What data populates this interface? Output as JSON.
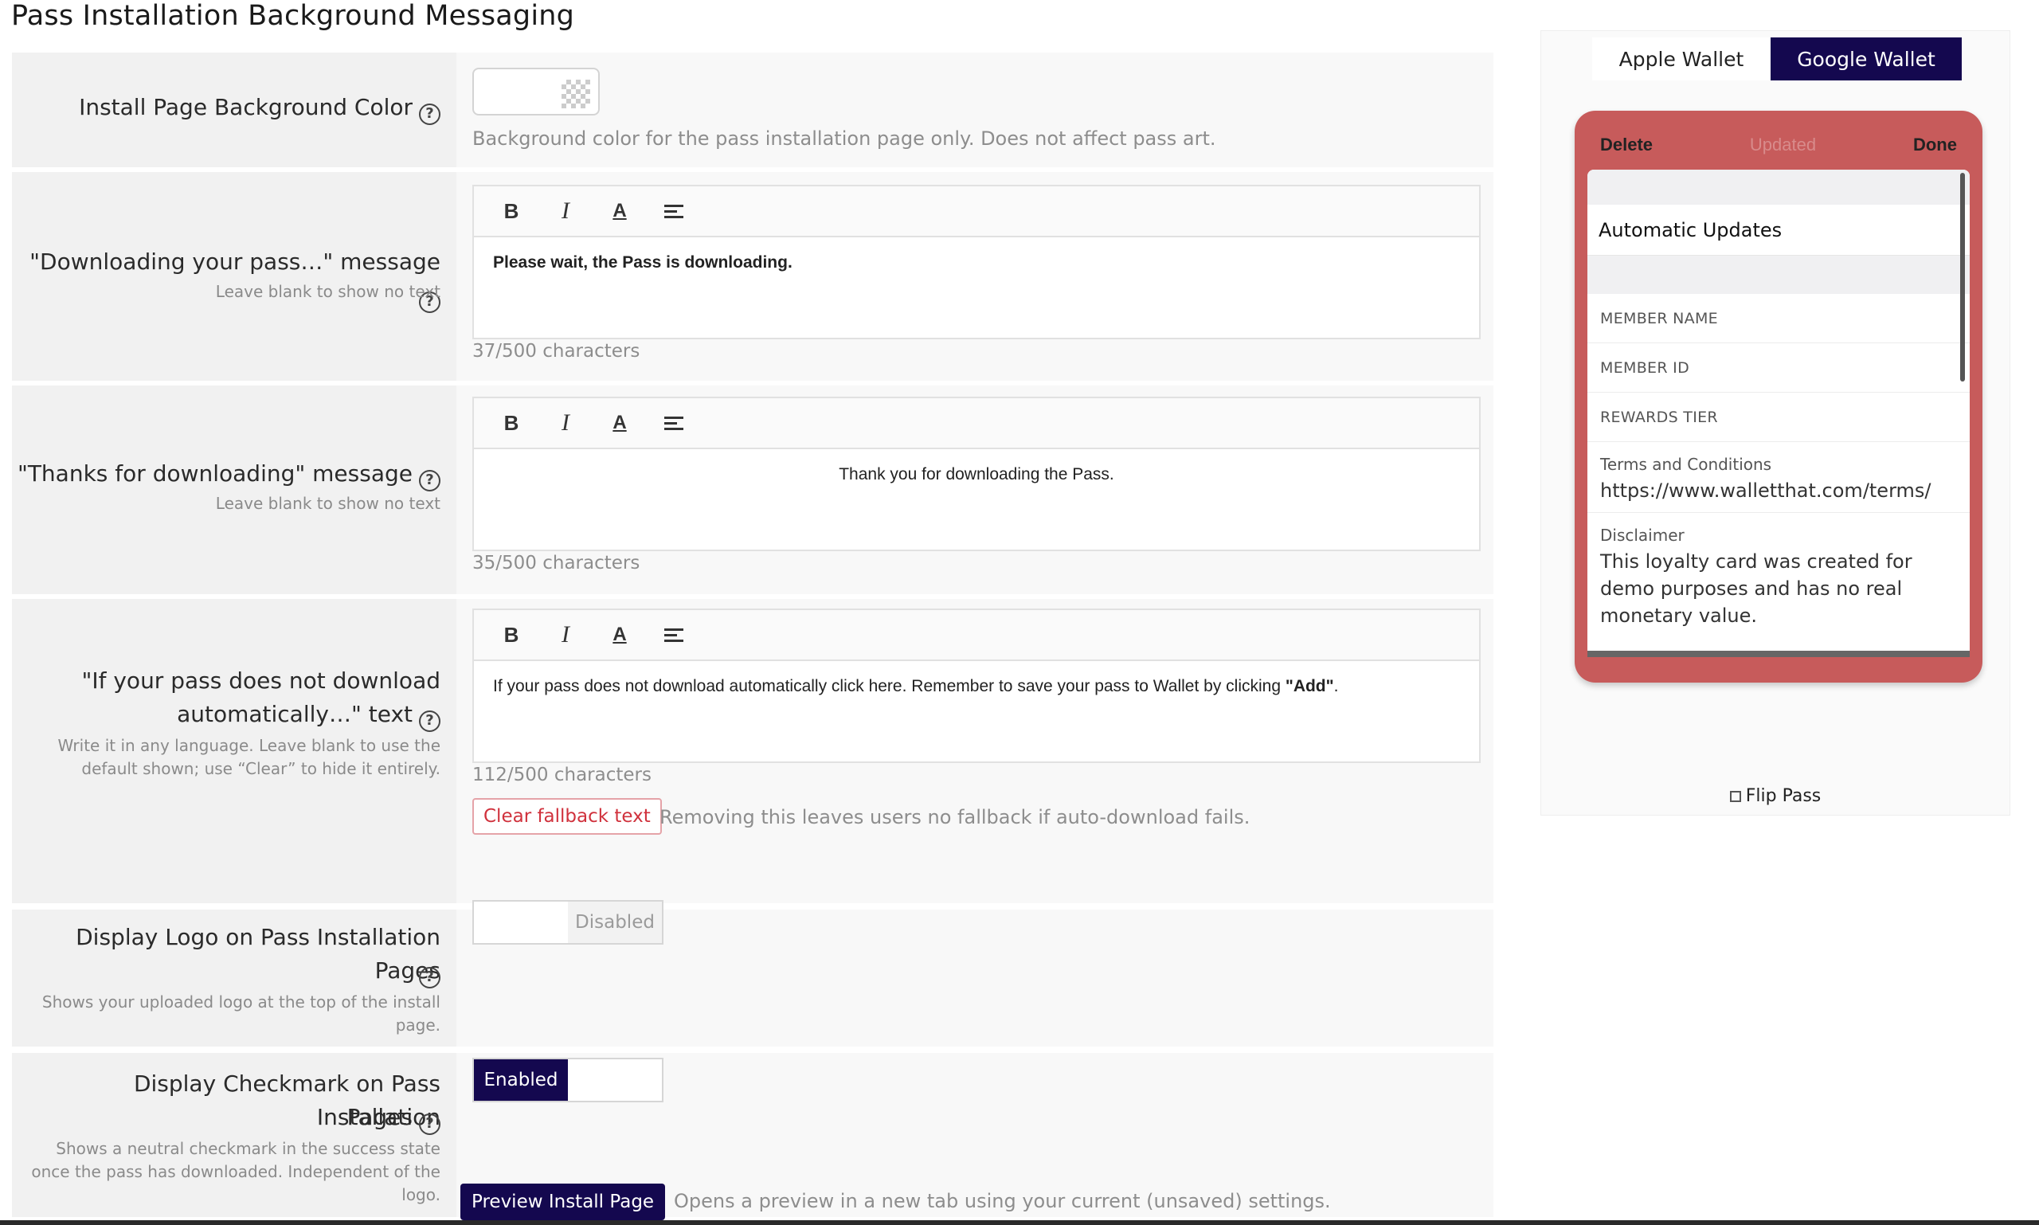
{
  "page": {
    "title": "Pass Installation Background Messaging"
  },
  "bg_color": {
    "label": "Install Page Background Color",
    "hint": "Background color for the pass installation page only. Does not affect pass art."
  },
  "downloading": {
    "label": "\"Downloading your pass…\" message",
    "sub": "Leave blank to show no text",
    "text": "Please wait, the Pass is downloading.",
    "counter": "37/500 characters"
  },
  "thanks": {
    "label": "\"Thanks for downloading\" message",
    "sub": "Leave blank to show no text",
    "text": "Thank you for downloading the Pass.",
    "counter": "35/500 characters"
  },
  "fallback": {
    "label_line1": "\"If your pass does not download",
    "label_line2": "automatically…\" text",
    "sub_line1": "Write it in any language. Leave blank to use the",
    "sub_line2": "default shown; use “Clear” to hide it entirely.",
    "text_before": "If your pass does not download automatically click here. Remember to save your pass to Wallet by clicking ",
    "text_bold": "\"Add\"",
    "text_after": ".",
    "counter": "112/500 characters",
    "clear_label": "Clear fallback text",
    "clear_hint": "Removing this leaves users no fallback if auto-download fails."
  },
  "logo": {
    "label_line1": "Display Logo on Pass Installation Pages",
    "sub_line1": "Shows your uploaded logo at the top of the install",
    "sub_line2": "page.",
    "state": "Disabled"
  },
  "checkmark": {
    "label_line1": "Display Checkmark on Pass Installation",
    "label_line2": "Pages",
    "sub_line1": "Shows a neutral checkmark in the success state",
    "sub_line2": "once the pass has downloaded. Independent of the",
    "sub_line3": "logo.",
    "state": "Enabled"
  },
  "preview": {
    "button": "Preview Install Page",
    "hint": "Opens a preview in a new tab using your current (unsaved) settings."
  },
  "wallet": {
    "tabs": [
      "Apple Wallet",
      "Google Wallet"
    ],
    "selected": "Google Wallet",
    "device": {
      "delete": "Delete",
      "updated": "Updated",
      "done": "Done",
      "automatic_updates": "Automatic Updates",
      "fields": [
        "MEMBER NAME",
        "MEMBER ID",
        "REWARDS TIER"
      ],
      "terms_key": "Terms and Conditions",
      "terms_value": "https://www.walletthat.com/terms/",
      "disclaimer_key": "Disclaimer",
      "disclaimer_value": "This loyalty card was created for demo purposes and has no real monetary value."
    },
    "flip_label": "Flip Pass"
  },
  "colors": {
    "accent": "#14084f",
    "device": "#c75b5b",
    "danger": "#d0313c"
  }
}
